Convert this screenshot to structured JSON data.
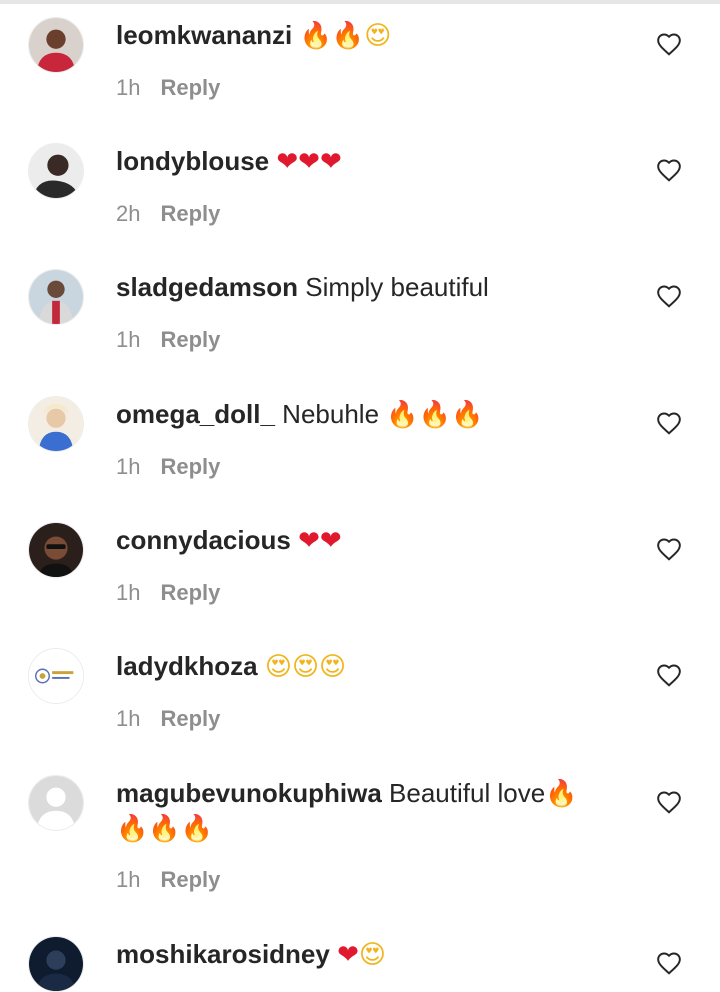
{
  "comments": [
    {
      "username": "leomkwananzi",
      "text": "",
      "emoji": [
        {
          "g": "🔥",
          "k": "fire"
        },
        {
          "g": "🔥",
          "k": "fire"
        },
        {
          "g": "😍",
          "k": "face"
        }
      ],
      "time": "1h",
      "reply": "Reply"
    },
    {
      "username": "londyblouse",
      "text": "",
      "emoji": [
        {
          "g": "❤",
          "k": "heart"
        },
        {
          "g": "❤",
          "k": "heart"
        },
        {
          "g": "❤",
          "k": "heart"
        }
      ],
      "time": "2h",
      "reply": "Reply"
    },
    {
      "username": "sladgedamson",
      "text": "Simply beautiful",
      "emoji": [],
      "time": "1h",
      "reply": "Reply"
    },
    {
      "username": "omega_doll_",
      "text": "Nebuhle",
      "emoji": [
        {
          "g": "🔥",
          "k": "fire"
        },
        {
          "g": "🔥",
          "k": "fire"
        },
        {
          "g": "🔥",
          "k": "fire"
        }
      ],
      "time": "1h",
      "reply": "Reply"
    },
    {
      "username": "connydacious",
      "text": "",
      "emoji": [
        {
          "g": "❤",
          "k": "heart"
        },
        {
          "g": "❤",
          "k": "heart"
        }
      ],
      "time": "1h",
      "reply": "Reply"
    },
    {
      "username": "ladydkhoza",
      "text": "",
      "emoji": [
        {
          "g": "😍",
          "k": "face"
        },
        {
          "g": "😍",
          "k": "face"
        },
        {
          "g": "😍",
          "k": "face"
        }
      ],
      "time": "1h",
      "reply": "Reply"
    },
    {
      "username": "magubevunokuphiwa",
      "text": "Beautiful love",
      "emoji": [
        {
          "g": "🔥",
          "k": "fire"
        },
        {
          "g": "🔥",
          "k": "fire"
        },
        {
          "g": "🔥",
          "k": "fire"
        },
        {
          "g": "🔥",
          "k": "fire"
        }
      ],
      "time": "1h",
      "reply": "Reply"
    },
    {
      "username": "moshikarosidney",
      "text": "",
      "emoji": [
        {
          "g": "❤",
          "k": "heart"
        },
        {
          "g": "😍",
          "k": "face"
        }
      ],
      "time": "",
      "reply": ""
    }
  ],
  "colors": {
    "text": "#262626",
    "meta": "#8e8e8e",
    "fire": "#f26b1d",
    "heart": "#e0192e",
    "face": "#f1b41b"
  },
  "icons": {
    "like": "heart-outline-icon"
  }
}
